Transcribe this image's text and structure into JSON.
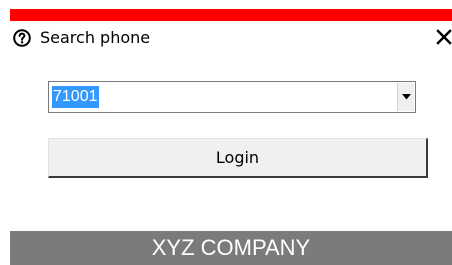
{
  "colors": {
    "accent_bar": "#ff0000",
    "footer_bg": "#7b7b7b",
    "selection": "#3399ff"
  },
  "header": {
    "help_icon": "question-circle-icon",
    "title": "Search phone",
    "close_icon": "close-icon"
  },
  "form": {
    "phone_select": {
      "value": "71001",
      "arrow_icon": "chevron-down-icon"
    },
    "login_label": "Login"
  },
  "footer": {
    "company": "XYZ COMPANY"
  }
}
